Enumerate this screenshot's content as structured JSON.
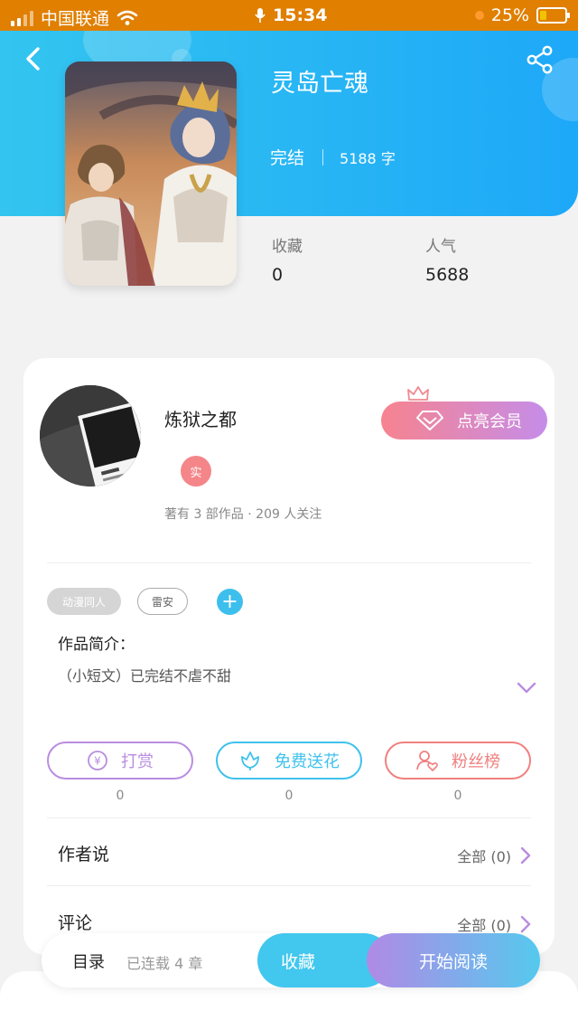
{
  "status_bar": {
    "carrier": "中国联通",
    "time": "15:34",
    "battery_percent": "25%",
    "battery_level": 0.25
  },
  "header": {
    "back_icon": "chevron-left-icon",
    "share_icon": "share-icon"
  },
  "book": {
    "title": "灵岛亡魂",
    "status": "完结",
    "word_count": "5188 字",
    "stats": [
      {
        "label": "收藏",
        "value": "0"
      },
      {
        "label": "人气",
        "value": "5688"
      }
    ]
  },
  "author": {
    "name": "炼狱之都",
    "badge": "实",
    "meta": "著有 3 部作品 · 209 人关注",
    "vip_label": "点亮会员"
  },
  "tags": [
    "动漫同人",
    "雷安"
  ],
  "intro": {
    "label": "作品简介：",
    "text": "（小短文）已完结不虐不甜"
  },
  "actions": [
    {
      "label": "打赏",
      "count": "0",
      "icon": "yuan-coin-icon",
      "color": "#b98de0"
    },
    {
      "label": "免费送花",
      "count": "0",
      "icon": "flower-icon",
      "color": "#3fc2ec"
    },
    {
      "label": "粉丝榜",
      "count": "0",
      "icon": "fan-heart-icon",
      "color": "#f08080"
    }
  ],
  "rows": {
    "author_says": {
      "label": "作者说",
      "right": "全部 (0)"
    },
    "comments": {
      "label": "评论",
      "right": "全部 (0)"
    }
  },
  "bottom": {
    "toc": "目录",
    "chapters": "已连载 4 章",
    "favorite": "收藏",
    "read": "开始阅读"
  },
  "colors": {
    "header_start": "#33c5ef",
    "header_end": "#1ea8f8",
    "status_bar": "#e07f00",
    "accent_purple": "#b98de0",
    "accent_blue": "#3fc2ec",
    "accent_red": "#f08080"
  }
}
